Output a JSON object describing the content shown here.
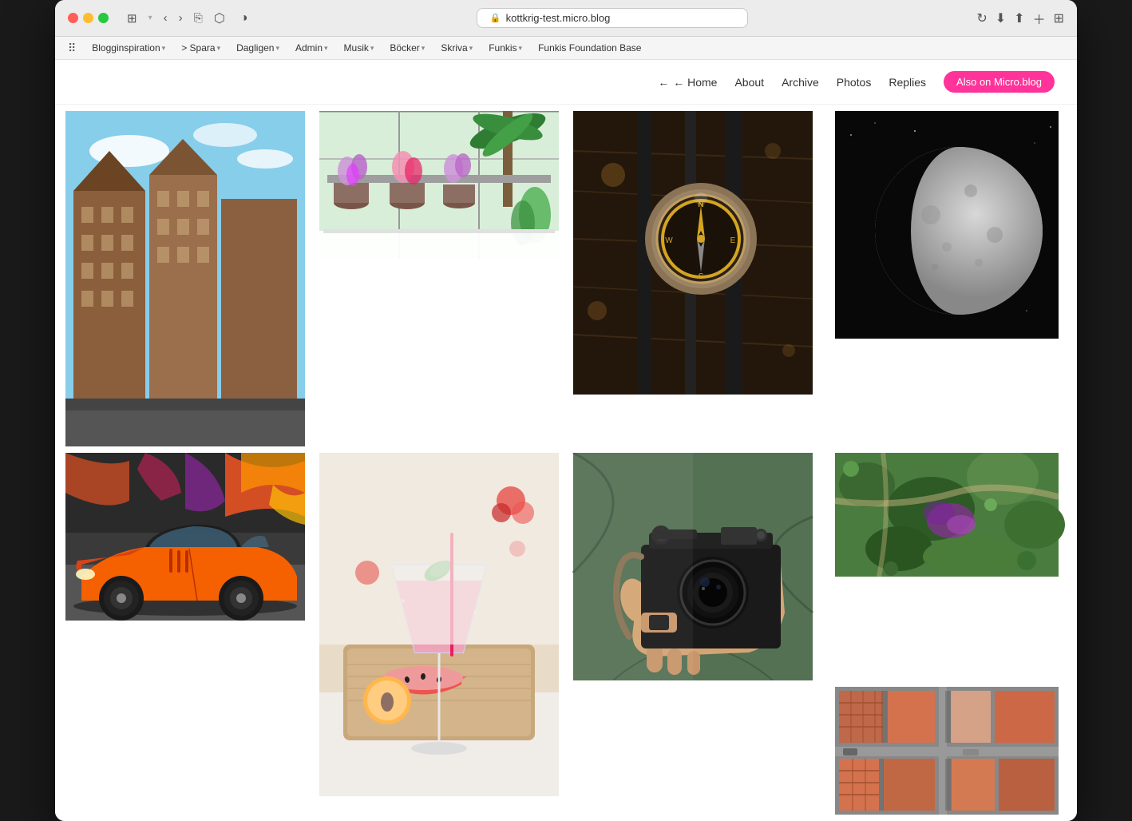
{
  "browser": {
    "url": "kottkrig-test.micro.blog",
    "traffic_lights": [
      "red",
      "yellow",
      "green"
    ]
  },
  "bookmarks": {
    "items": [
      {
        "label": "Blogginspiration",
        "has_chevron": true
      },
      {
        "label": "> Spara",
        "has_chevron": true
      },
      {
        "label": "Dagligen",
        "has_chevron": true
      },
      {
        "label": "Admin",
        "has_chevron": true
      },
      {
        "label": "Musik",
        "has_chevron": true
      },
      {
        "label": "Böcker",
        "has_chevron": true
      },
      {
        "label": "Skriva",
        "has_chevron": true
      },
      {
        "label": "Funkis",
        "has_chevron": true
      },
      {
        "label": "Funkis Foundation Base",
        "has_chevron": false
      }
    ]
  },
  "site_nav": {
    "links": [
      {
        "label": "← Home",
        "key": "home"
      },
      {
        "label": "About",
        "key": "about"
      },
      {
        "label": "Archive",
        "key": "archive"
      },
      {
        "label": "Photos",
        "key": "photos"
      },
      {
        "label": "Replies",
        "key": "replies"
      }
    ],
    "cta_label": "Also on Micro.blog"
  },
  "photos": {
    "cells": [
      {
        "key": "building",
        "alt": "Victorian brick buildings against blue sky"
      },
      {
        "key": "greenhouse",
        "alt": "Plants in greenhouse with pink flowers"
      },
      {
        "key": "compass",
        "alt": "Compass on dark wooden surface"
      },
      {
        "key": "moon",
        "alt": "Crescent moon on black background"
      },
      {
        "key": "cocktail",
        "alt": "Cocktail glass with fruit on cutting board"
      },
      {
        "key": "camera",
        "alt": "Person holding Pentax film camera"
      },
      {
        "key": "aerial1",
        "alt": "Aerial view of green landscape"
      },
      {
        "key": "aerial2",
        "alt": "Aerial view of terracotta rooftops"
      },
      {
        "key": "car",
        "alt": "Orange vintage car with graffiti"
      }
    ]
  }
}
